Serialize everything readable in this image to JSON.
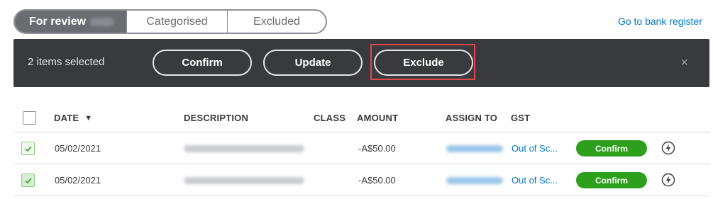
{
  "tabs": [
    {
      "label": "For review",
      "active": true
    },
    {
      "label": "Categorised",
      "active": false
    },
    {
      "label": "Excluded",
      "active": false
    }
  ],
  "bank_register_link": "Go to bank register",
  "batch_bar": {
    "selected_text": "2 items selected",
    "confirm_label": "Confirm",
    "update_label": "Update",
    "exclude_label": "Exclude",
    "close_glyph": "×"
  },
  "table": {
    "columns": {
      "date": "DATE",
      "sort_glyph": "▼",
      "description": "DESCRIPTION",
      "class": "CLASS",
      "amount": "AMOUNT",
      "assign_to": "ASSIGN TO",
      "gst": "GST"
    },
    "rows": [
      {
        "date": "05/02/2021",
        "amount": "-A$50.00",
        "gst": "Out of Sc...",
        "action_label": "Confirm",
        "checked": true
      },
      {
        "date": "05/02/2021",
        "amount": "-A$50.00",
        "gst": "Out of Sc...",
        "action_label": "Confirm",
        "checked": true
      }
    ]
  },
  "colors": {
    "batch_bar_bg": "#393a3d",
    "highlight_border": "#e2464f",
    "confirm_green": "#2ca01c",
    "link_blue": "#0077c5",
    "active_tab_bg": "#6b6c72"
  },
  "icons": {
    "row_action": "lightning-bolt-icon",
    "checkbox_check": "checkmark-icon",
    "sort": "sort-descending-icon",
    "close": "close-icon"
  }
}
